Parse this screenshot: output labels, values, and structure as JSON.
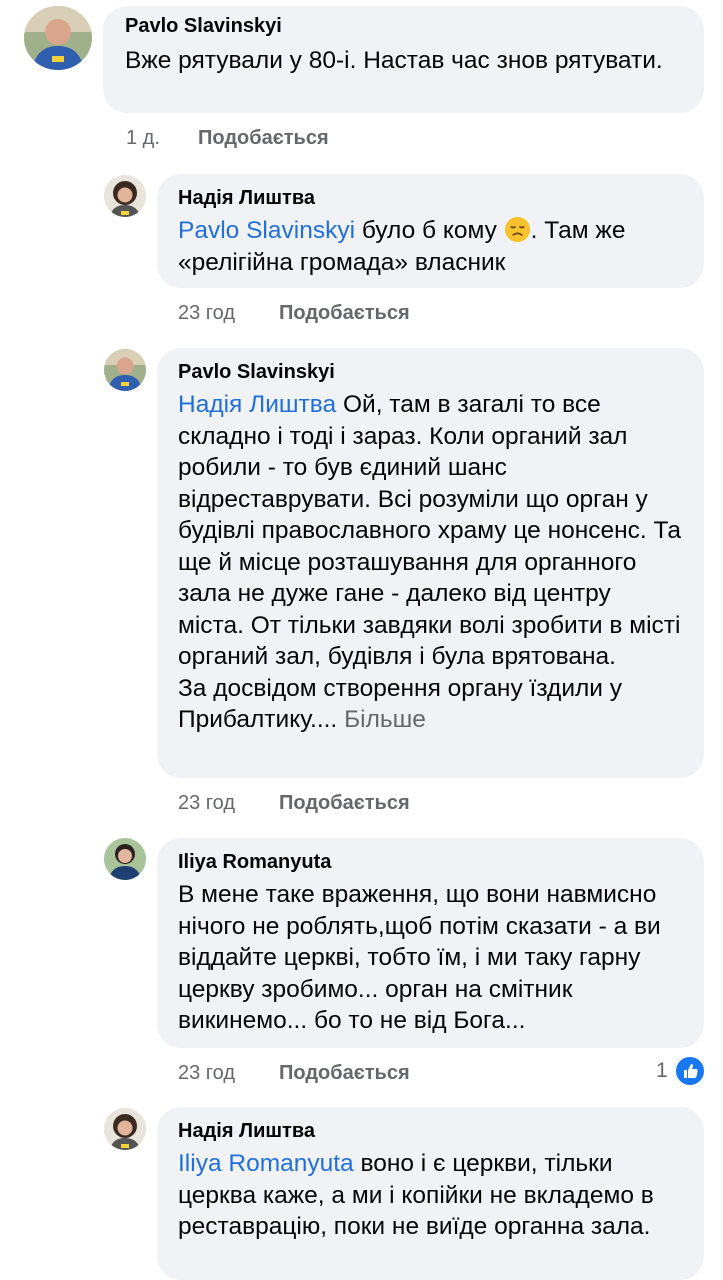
{
  "comments": [
    {
      "author": "Pavlo Slavinskyi",
      "text": "Вже рятували у 80-і. Настав час знов рятувати.",
      "time": "1 д.",
      "like_label": "Подобається"
    },
    {
      "author": "Надія Лиштва",
      "mention": "Pavlo Slavinskyi",
      "text_before_emoji": " було б кому ",
      "emoji": "disappointed-face-icon",
      "text_after_emoji": ". Там же «релігійна громада» власник",
      "time": "23 год",
      "like_label": "Подобається"
    },
    {
      "author": "Pavlo Slavinskyi",
      "mention": "Надія Лиштва",
      "text": " Ой, там в загалі то все складно і тоді і зараз. Коли органий зал робили - то був єдиний шанс відреставрувати. Всі розуміли що орган у будівлі православного храму це нонсенс. Та ще й місце розташування для органного зала не дуже гане - далеко від центру міста. От тільки завдяки волі зробити в місті органий зал, будівля і була врятована.",
      "text2": "За досвідом створення органу їздили у Прибалтику....",
      "more_label": "Більше",
      "time": "23 год",
      "like_label": "Подобається"
    },
    {
      "author": "Iliya Romanyuta",
      "text": "В мене таке враження, що вони навмисно нічого не роблять,щоб потім сказати - а ви віддайте церкві, тобто їм, і ми таку гарну церкву зробимо... орган на смітник викинемо... бо то не від Бога...",
      "time": "23 год",
      "like_label": "Подобається",
      "reaction_count": "1",
      "reaction_icon": "like-thumb-icon"
    },
    {
      "author": "Надія Лиштва",
      "mention": "Iliya Romanyuta",
      "text": " воно і є церкви, тільки церква каже, а ми і копійки не вкладемо в реставрацію, поки не виїде органна зала."
    }
  ],
  "colors": {
    "bubble": "#f0f2f5",
    "mention": "#216fdb",
    "meta": "#65676b",
    "like_badge": "#1877f2"
  }
}
